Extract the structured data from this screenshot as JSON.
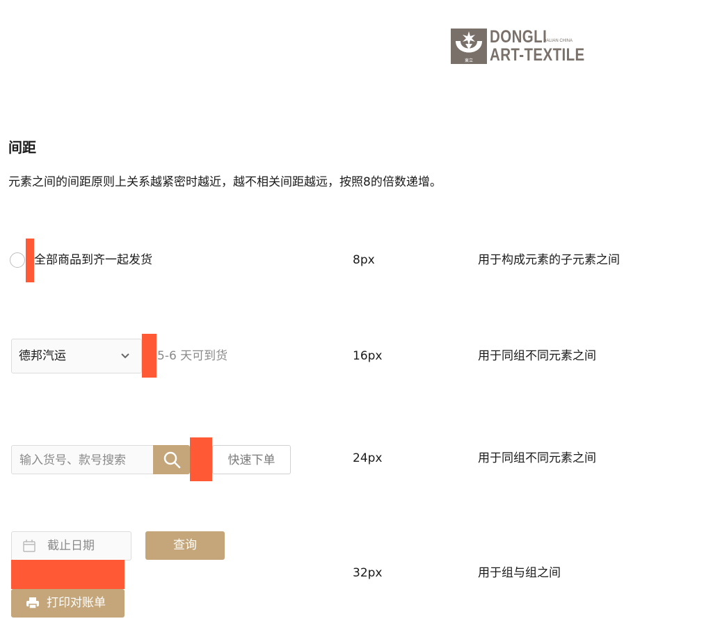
{
  "logo": {
    "line1": "DONGLI",
    "sub": "DALIAN CHINA",
    "line2": "ART-TEXTILE",
    "mark_text": "東立",
    "color": "#7a706a"
  },
  "section": {
    "title": "间距",
    "description": "元素之间的间距原则上关系越紧密时越近，越不相关间距越远，按照8的倍数递增。"
  },
  "colors": {
    "spacer": "#ff5a35",
    "accent": "#c4a67a",
    "muted_text": "#8a8a8a"
  },
  "rows": [
    {
      "value": "8px",
      "usage": "用于构成元素的子元素之间",
      "radio_label": "全部商品到齐一起发货"
    },
    {
      "value": "16px",
      "usage": "用于同组不同元素之间",
      "select_value": "德邦汽运",
      "hint": "5-6 天可到货"
    },
    {
      "value": "24px",
      "usage": "用于同组不同元素之间",
      "search_placeholder": "输入货号、款号搜索",
      "quick_order_label": "快速下单"
    },
    {
      "value": "32px",
      "usage": "用于组与组之间",
      "date_placeholder": "截止日期",
      "query_label": "查询",
      "print_label": "打印对账单"
    }
  ],
  "icons": {
    "select": "chevron-down-icon",
    "search": "search-icon",
    "date": "calendar-icon",
    "print": "printer-icon"
  }
}
